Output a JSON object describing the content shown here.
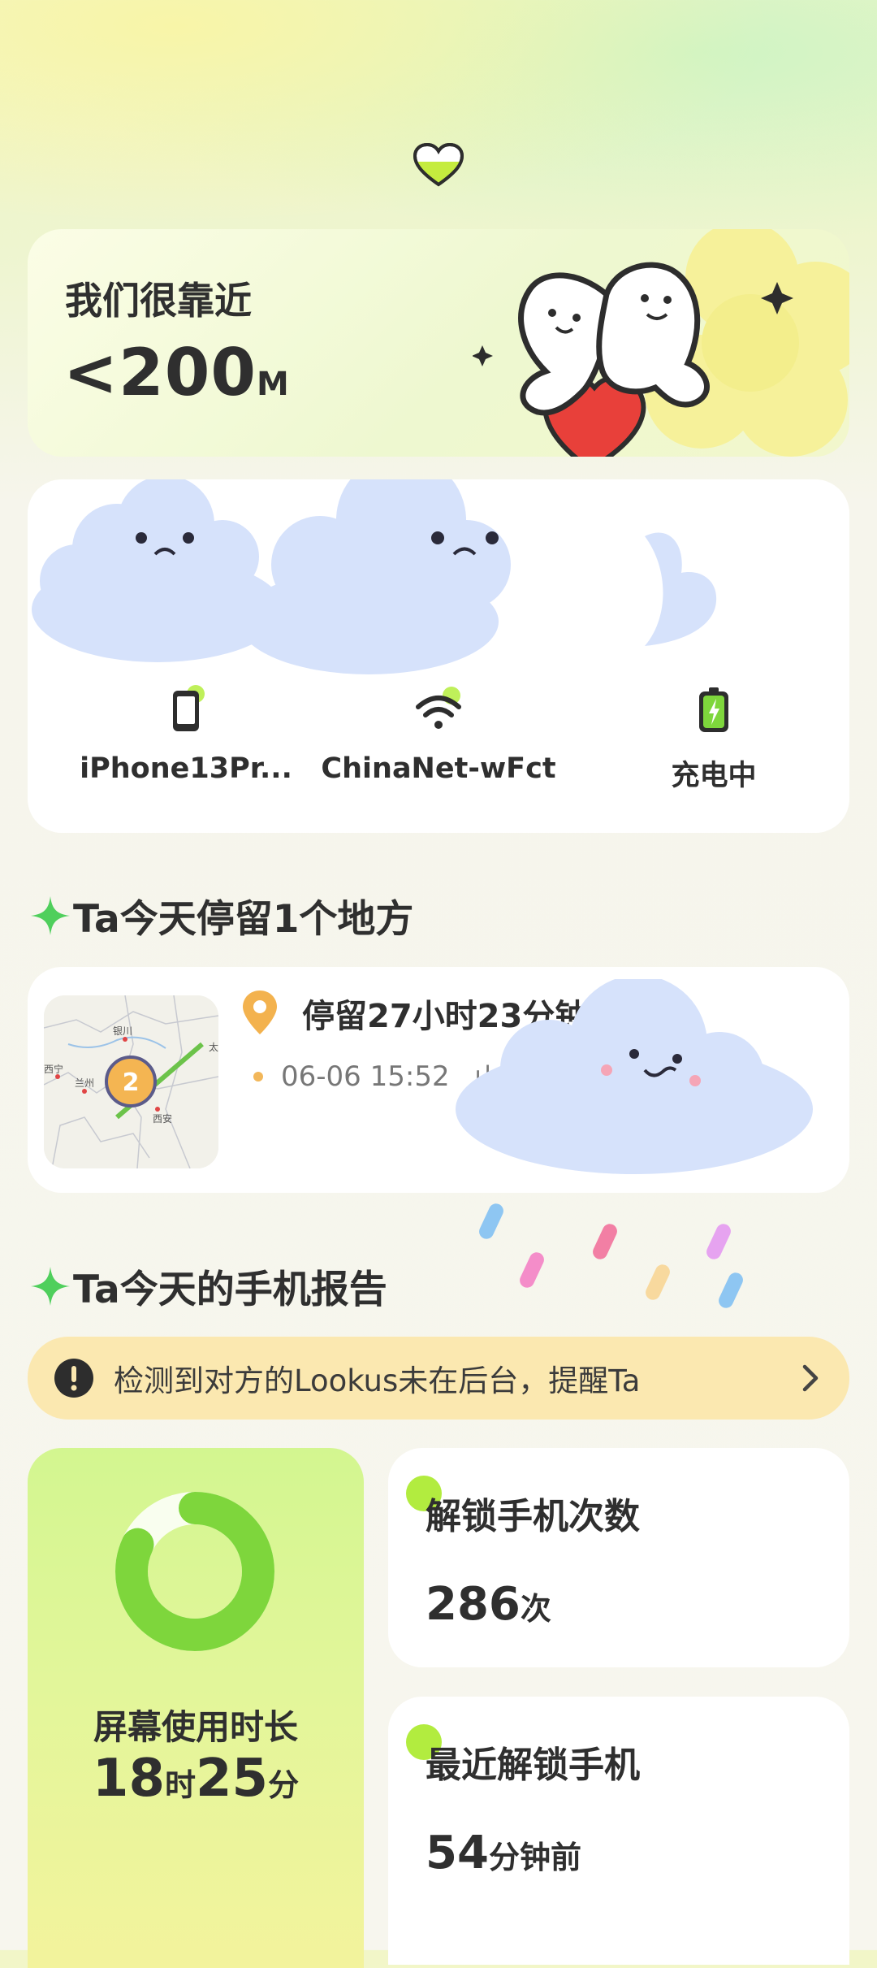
{
  "distance": {
    "title": "我们很靠近",
    "value": "<200",
    "unit": "M"
  },
  "device": {
    "phone_label": "iPhone13Pr...",
    "wifi_label": "ChinaNet-wFct",
    "battery_label": "充电中",
    "icons": [
      "phone-icon",
      "wifi-icon",
      "battery-charging-icon"
    ]
  },
  "places": {
    "title": "Ta今天停留1个地方",
    "item": {
      "stay": "停留27小时23分钟",
      "time": "06-06 15:52",
      "address": "山西",
      "map_badge": "2",
      "map_labels": [
        "银川",
        "西宁",
        "兰州",
        "西安",
        "太"
      ]
    }
  },
  "report": {
    "title": "Ta今天的手机报告",
    "alert": "检测到对方的Lookus未在后台，提醒Ta",
    "screen_time": {
      "label": "屏幕使用时长",
      "hours": "18",
      "hours_unit": "时",
      "minutes": "25",
      "minutes_unit": "分",
      "ring_fraction": 0.82
    },
    "unlock_count": {
      "label": "解锁手机次数",
      "value": "286",
      "unit": "次"
    },
    "last_unlock": {
      "label": "最近解锁手机",
      "value": "54",
      "unit": "分钟前"
    }
  },
  "colors": {
    "accent_green": "#7ed63c",
    "alert_bg": "#fbe8b0",
    "cloud_blue": "#d6e2fb",
    "pin_orange": "#f3b24e"
  }
}
